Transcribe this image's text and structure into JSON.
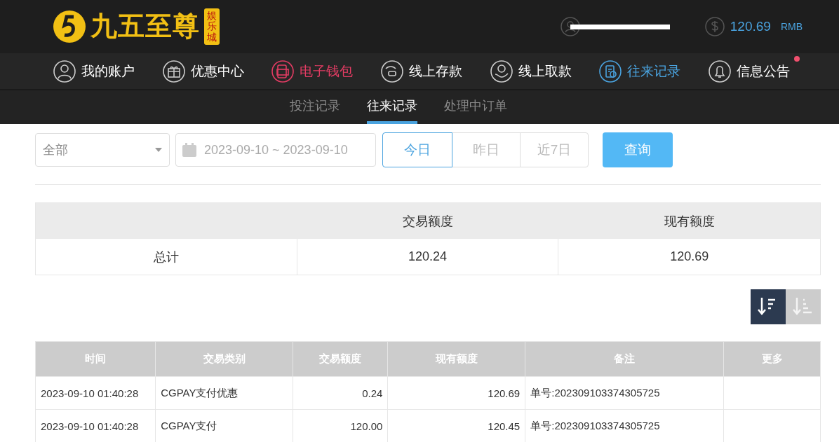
{
  "header": {
    "logo_text": "九五至尊",
    "logo_badge": "娱乐城",
    "username_redacted": true,
    "balance": "120.69",
    "currency": "RMB"
  },
  "nav": [
    {
      "label": "我的账户",
      "kind": "user",
      "selected": false
    },
    {
      "label": "优惠中心",
      "kind": "gift",
      "selected": false
    },
    {
      "label": "电子钱包",
      "kind": "wallet",
      "selected": false,
      "highlight": true
    },
    {
      "label": "线上存款",
      "kind": "deposit",
      "selected": false
    },
    {
      "label": "线上取款",
      "kind": "withdraw",
      "selected": false
    },
    {
      "label": "往来记录",
      "kind": "records",
      "selected": true
    },
    {
      "label": "信息公告",
      "kind": "bell",
      "selected": false,
      "badge": true
    }
  ],
  "subtabs": [
    {
      "label": "投注记录",
      "selected": false
    },
    {
      "label": "往来记录",
      "selected": true
    },
    {
      "label": "处理中订单",
      "selected": false
    }
  ],
  "filters": {
    "type_select": "全部",
    "date_range": "2023-09-10 ~ 2023-09-10",
    "quick_ranges": [
      {
        "label": "今日",
        "selected": true
      },
      {
        "label": "昨日",
        "selected": false
      },
      {
        "label": "近7日",
        "selected": false
      }
    ],
    "query_button": "查询"
  },
  "summary": {
    "columns": [
      "交易额度",
      "现有额度"
    ],
    "row_label": "总计",
    "values": [
      "120.24",
      "120.69"
    ]
  },
  "sort_buttons": [
    {
      "kind": "desc",
      "selected": true
    },
    {
      "kind": "asc",
      "selected": false
    }
  ],
  "table": {
    "columns": [
      "时间",
      "交易类别",
      "交易额度",
      "现有额度",
      "备注",
      "更多"
    ],
    "rows": [
      [
        "2023-09-10 01:40:28",
        "CGPAY支付优惠",
        "0.24",
        "120.69",
        "单号:202309103374305725",
        ""
      ],
      [
        "2023-09-10 01:40:28",
        "CGPAY支付",
        "120.00",
        "120.45",
        "单号:202309103374305725",
        ""
      ]
    ]
  }
}
